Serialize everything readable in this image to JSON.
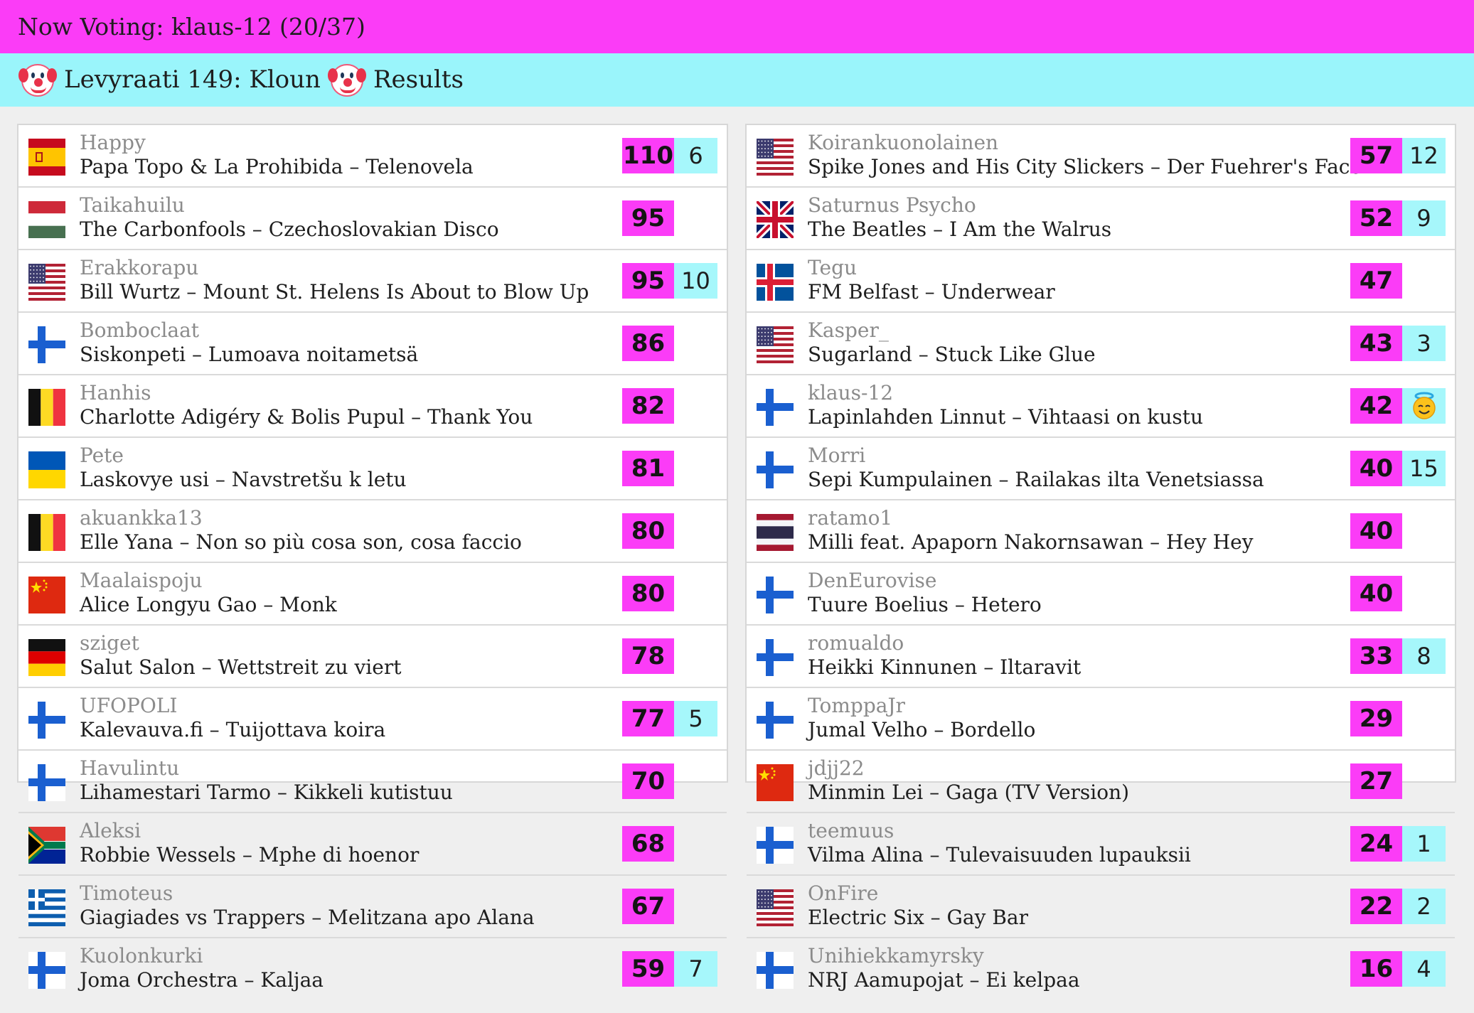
{
  "header": {
    "now_voting": "Now Voting: klaus-12 (20/37)"
  },
  "subheader": {
    "title": "Levyraati 149: Kloun",
    "results": "Results",
    "icon": "clown-face-icon"
  },
  "colors": {
    "pink": "#fb3cf7",
    "cyan": "#9af5fb",
    "panel_bg": "#ffffff",
    "page_bg": "#efefef"
  },
  "left_rows": [
    {
      "flag": "es",
      "voter": "Happy",
      "song": "Papa Topo & La Prohibida – Telenovela",
      "score": "110",
      "given": "6"
    },
    {
      "flag": "hu",
      "voter": "Taikahuilu",
      "song": "The Carbonfools – Czechoslovakian Disco",
      "score": "95",
      "given": ""
    },
    {
      "flag": "us",
      "voter": "Erakkorapu",
      "song": "Bill Wurtz – Mount St. Helens Is About to Blow Up",
      "score": "95",
      "given": "10"
    },
    {
      "flag": "fi",
      "voter": "Bomboclaat",
      "song": "Siskonpeti – Lumoava noitametsä",
      "score": "86",
      "given": ""
    },
    {
      "flag": "be",
      "voter": "Hanhis",
      "song": "Charlotte Adigéry & Bolis Pupul – Thank You",
      "score": "82",
      "given": ""
    },
    {
      "flag": "ua",
      "voter": "Pete",
      "song": "Laskovye usi – Navstretšu k letu",
      "score": "81",
      "given": ""
    },
    {
      "flag": "be",
      "voter": "akuankka13",
      "song": "Elle Yana – Non so più cosa son, cosa faccio",
      "score": "80",
      "given": ""
    },
    {
      "flag": "cn",
      "voter": "Maalaispoju",
      "song": "Alice Longyu Gao – Monk",
      "score": "80",
      "given": ""
    },
    {
      "flag": "de",
      "voter": "sziget",
      "song": "Salut Salon – Wettstreit zu viert",
      "score": "78",
      "given": ""
    },
    {
      "flag": "fi",
      "voter": "UFOPOLI",
      "song": "Kalevauva.fi – Tuijottava koira",
      "score": "77",
      "given": "5"
    },
    {
      "flag": "fi",
      "voter": "Havulintu",
      "song": "Lihamestari Tarmo – Kikkeli kutistuu",
      "score": "70",
      "given": ""
    },
    {
      "flag": "za",
      "voter": "Aleksi",
      "song": "Robbie Wessels – Mphe di hoenor",
      "score": "68",
      "given": ""
    },
    {
      "flag": "gr",
      "voter": "Timoteus",
      "song": "Giagiades vs Trappers – Melitzana apo Alana",
      "score": "67",
      "given": ""
    },
    {
      "flag": "fi",
      "voter": "Kuolonkurki",
      "song": "Joma Orchestra – Kaljaa",
      "score": "59",
      "given": "7"
    }
  ],
  "right_rows": [
    {
      "flag": "us",
      "voter": "Koirankuonolainen",
      "song": "Spike Jones and His City Slickers – Der Fuehrer's Face",
      "score": "57",
      "given": "12"
    },
    {
      "flag": "gb",
      "voter": "Saturnus Psycho",
      "song": "The Beatles – I Am the Walrus",
      "score": "52",
      "given": "9"
    },
    {
      "flag": "is",
      "voter": "Tegu",
      "song": "FM Belfast – Underwear",
      "score": "47",
      "given": ""
    },
    {
      "flag": "us",
      "voter": "Kasper_",
      "song": "Sugarland – Stuck Like Glue",
      "score": "43",
      "given": "3"
    },
    {
      "flag": "fi",
      "voter": "klaus-12",
      "song": "Lapinlahden Linnut – Vihtaasi on kustu",
      "score": "42",
      "given": "",
      "given_icon": "smiling-face-with-halo-icon"
    },
    {
      "flag": "fi",
      "voter": "Morri",
      "song": "Sepi Kumpulainen – Railakas ilta Venetsiassa",
      "score": "40",
      "given": "15"
    },
    {
      "flag": "th",
      "voter": "ratamo1",
      "song": "Milli feat. Apaporn Nakornsawan – Hey Hey",
      "score": "40",
      "given": ""
    },
    {
      "flag": "fi",
      "voter": "DenEurovise",
      "song": "Tuure Boelius – Hetero",
      "score": "40",
      "given": ""
    },
    {
      "flag": "fi",
      "voter": "romualdo",
      "song": "Heikki Kinnunen – Iltaravit",
      "score": "33",
      "given": "8"
    },
    {
      "flag": "fi",
      "voter": "TomppaJr",
      "song": "Jumal Velho – Bordello",
      "score": "29",
      "given": ""
    },
    {
      "flag": "cn",
      "voter": "jdjj22",
      "song": "Minmin Lei – Gaga (TV Version)",
      "score": "27",
      "given": ""
    },
    {
      "flag": "fi",
      "voter": "teemuus",
      "song": "Vilma Alina – Tulevaisuuden lupauksii",
      "score": "24",
      "given": "1"
    },
    {
      "flag": "us",
      "voter": "OnFire",
      "song": "Electric Six – Gay Bar",
      "score": "22",
      "given": "2"
    },
    {
      "flag": "fi",
      "voter": "Unihiekkamyrsky",
      "song": "NRJ Aamupojat – Ei kelpaa",
      "score": "16",
      "given": "4"
    }
  ]
}
